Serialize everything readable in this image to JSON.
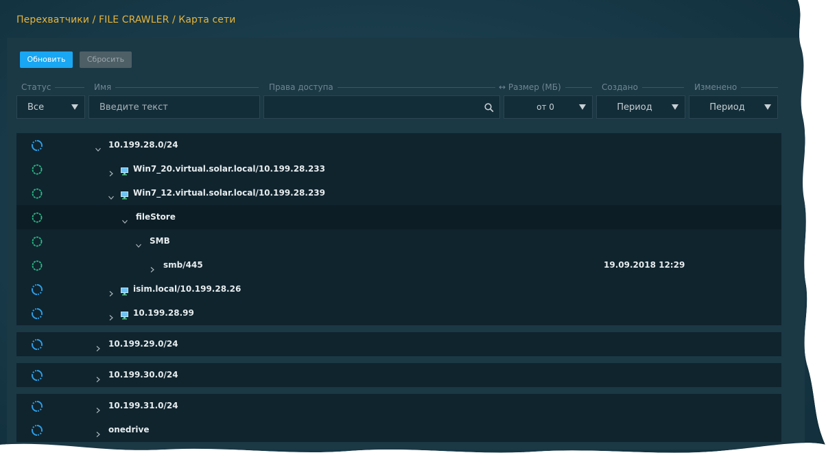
{
  "breadcrumb": "Перехватчики / FILE CRAWLER / Карта сети",
  "toolbar": {
    "refresh_label": "Обновить",
    "reset_label": "Сбросить"
  },
  "filters": {
    "status_label": "Статус",
    "name_label": "Имя",
    "access_label": "Права доступа",
    "size_label": "↔ Размер (МБ)",
    "created_label": "Создано",
    "modified_label": "Изменено",
    "status_value": "Все",
    "name_placeholder": "Введите текст",
    "access_value": "",
    "size_value": "от 0",
    "created_value": "Период",
    "modified_value": "Период"
  },
  "colors": {
    "accent": "#19a6f2",
    "breadcrumb": "#e8b53a",
    "status_icon": "#2d9fe8",
    "status_ok": "#2bbf8a",
    "panel": "#1b3845"
  },
  "tree": {
    "group1": [
      {
        "label": "10.199.28.0/24",
        "status": "sync-icon",
        "expanded": true,
        "host": false,
        "date": ""
      },
      {
        "label": "Win7_20.virtual.solar.local/10.199.28.233",
        "status": "gear-icon",
        "expanded": false,
        "host": true,
        "date": ""
      },
      {
        "label": "Win7_12.virtual.solar.local/10.199.28.239",
        "status": "gear-icon",
        "expanded": true,
        "host": true,
        "date": ""
      },
      {
        "label": "fileStore",
        "status": "gear-icon",
        "expanded": true,
        "host": false,
        "date": ""
      },
      {
        "label": "SMB",
        "status": "gear-icon",
        "expanded": true,
        "host": false,
        "date": ""
      },
      {
        "label": "smb/445",
        "status": "gear-icon",
        "expanded": false,
        "host": false,
        "date": "19.09.2018 12:29"
      },
      {
        "label": "isim.local/10.199.28.26",
        "status": "sync-icon",
        "expanded": false,
        "host": true,
        "date": ""
      },
      {
        "label": "10.199.28.99",
        "status": "sync-icon",
        "expanded": false,
        "host": true,
        "date": ""
      }
    ],
    "group2": [
      {
        "label": "10.199.29.0/24",
        "status": "sync-icon",
        "expanded": false,
        "host": false,
        "date": ""
      }
    ],
    "group3": [
      {
        "label": "10.199.30.0/24",
        "status": "sync-icon",
        "expanded": false,
        "host": false,
        "date": ""
      }
    ],
    "group4": [
      {
        "label": "10.199.31.0/24",
        "status": "sync-icon",
        "expanded": false,
        "host": false,
        "date": ""
      },
      {
        "label": "onedrive",
        "status": "sync-icon",
        "expanded": false,
        "host": false,
        "date": ""
      }
    ]
  }
}
